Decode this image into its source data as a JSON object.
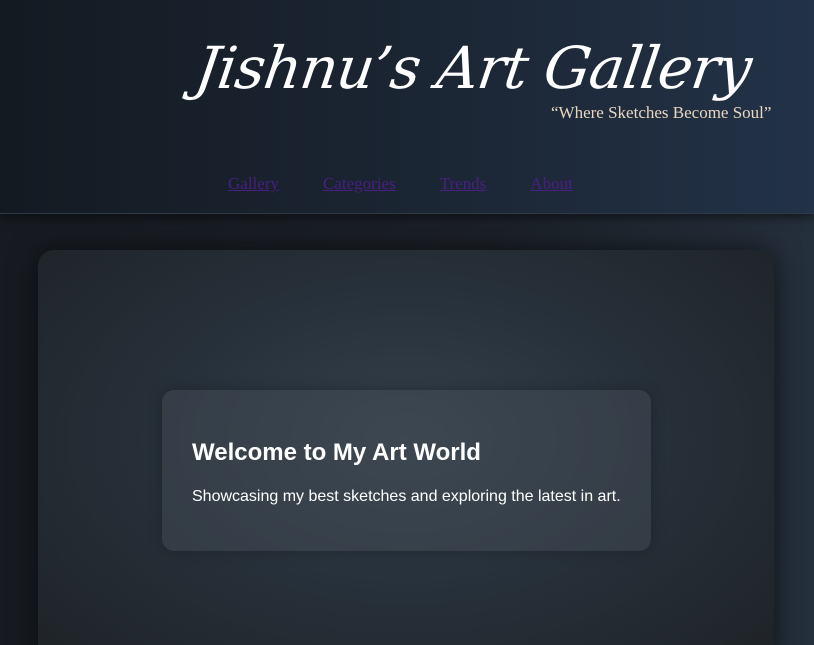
{
  "header": {
    "title": "Jishnu’s Art Gallery",
    "tagline": "“Where Sketches Become Soul”"
  },
  "nav": {
    "items": [
      {
        "label": "Gallery"
      },
      {
        "label": "Categories"
      },
      {
        "label": "Trends"
      },
      {
        "label": "About"
      }
    ]
  },
  "hero": {
    "heading": "Welcome to My Art World",
    "text": "Showcasing my best sketches and exploring the latest in art."
  },
  "colors": {
    "background": "#1b2028",
    "header_bg": "#1a2431",
    "title": "#ffffff",
    "tagline": "#e8d6c0",
    "nav_link": "#4a1f82",
    "card_bg": "#27313b"
  }
}
